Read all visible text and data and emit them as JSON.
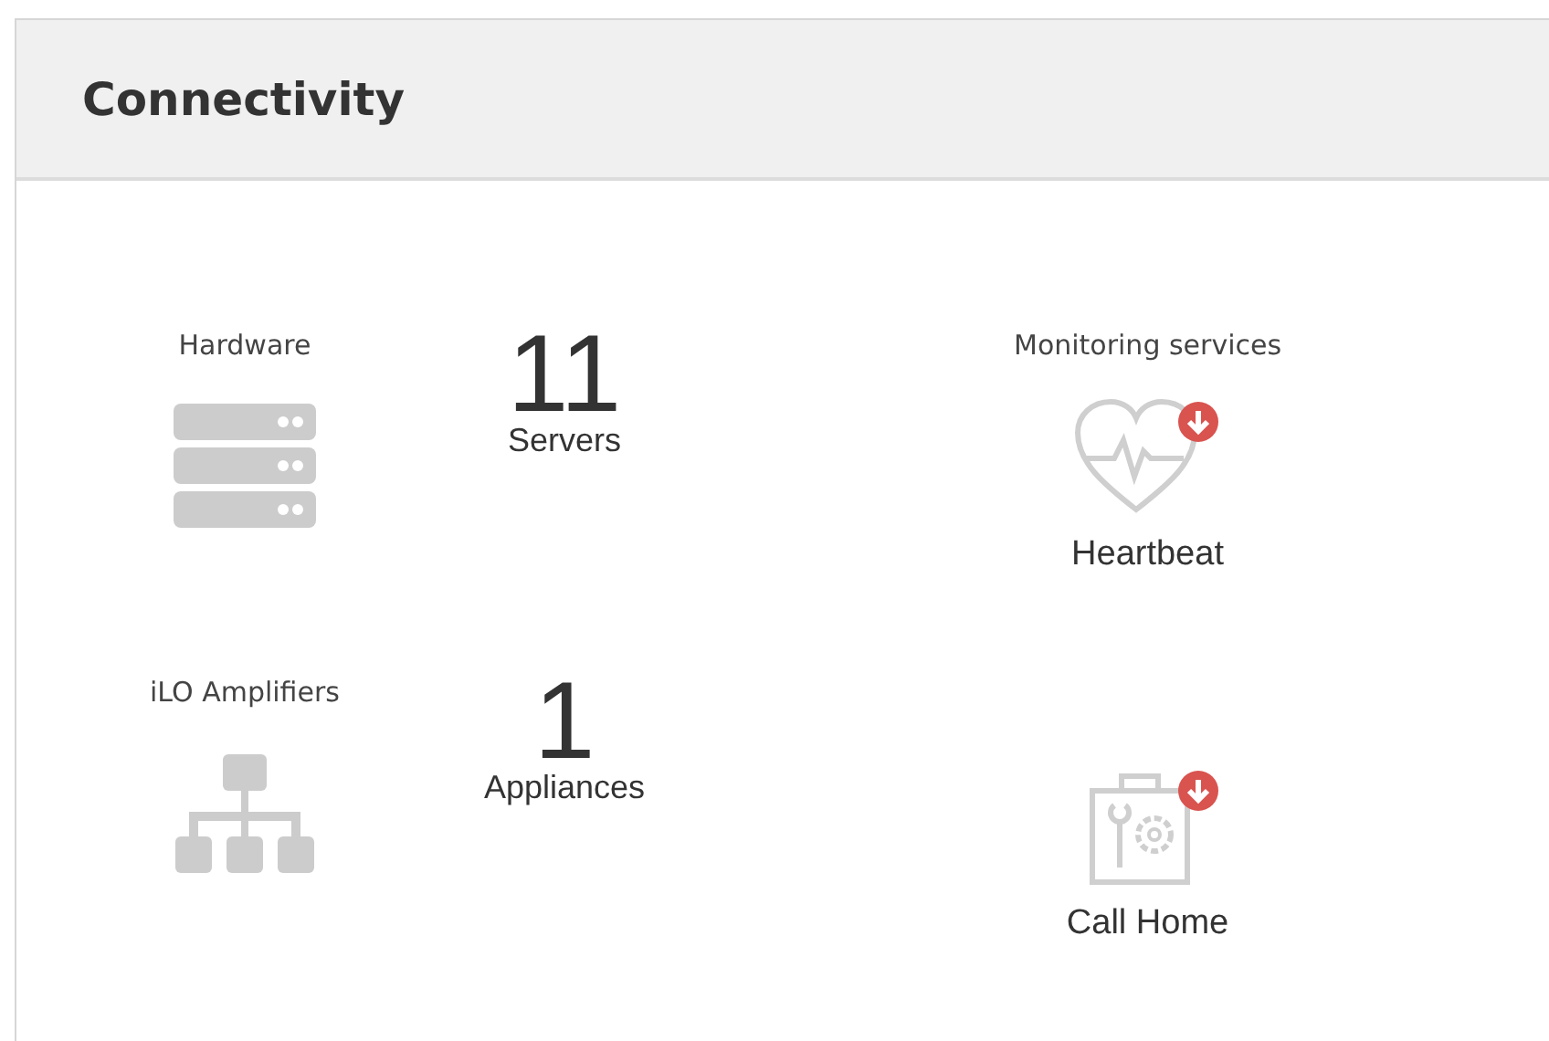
{
  "panel": {
    "title": "Connectivity"
  },
  "inventory": [
    {
      "kind": "servers",
      "label": "Hardware",
      "count": "11",
      "unit": "Servers"
    },
    {
      "kind": "network",
      "label": "iLO Amplifiers",
      "count": "1",
      "unit": "Appliances"
    }
  ],
  "services": [
    {
      "kind": "heartbeat",
      "heading": "Monitoring services",
      "name": "Heartbeat",
      "alert": true
    },
    {
      "kind": "toolbox",
      "name": "Call Home",
      "alert": true
    }
  ]
}
